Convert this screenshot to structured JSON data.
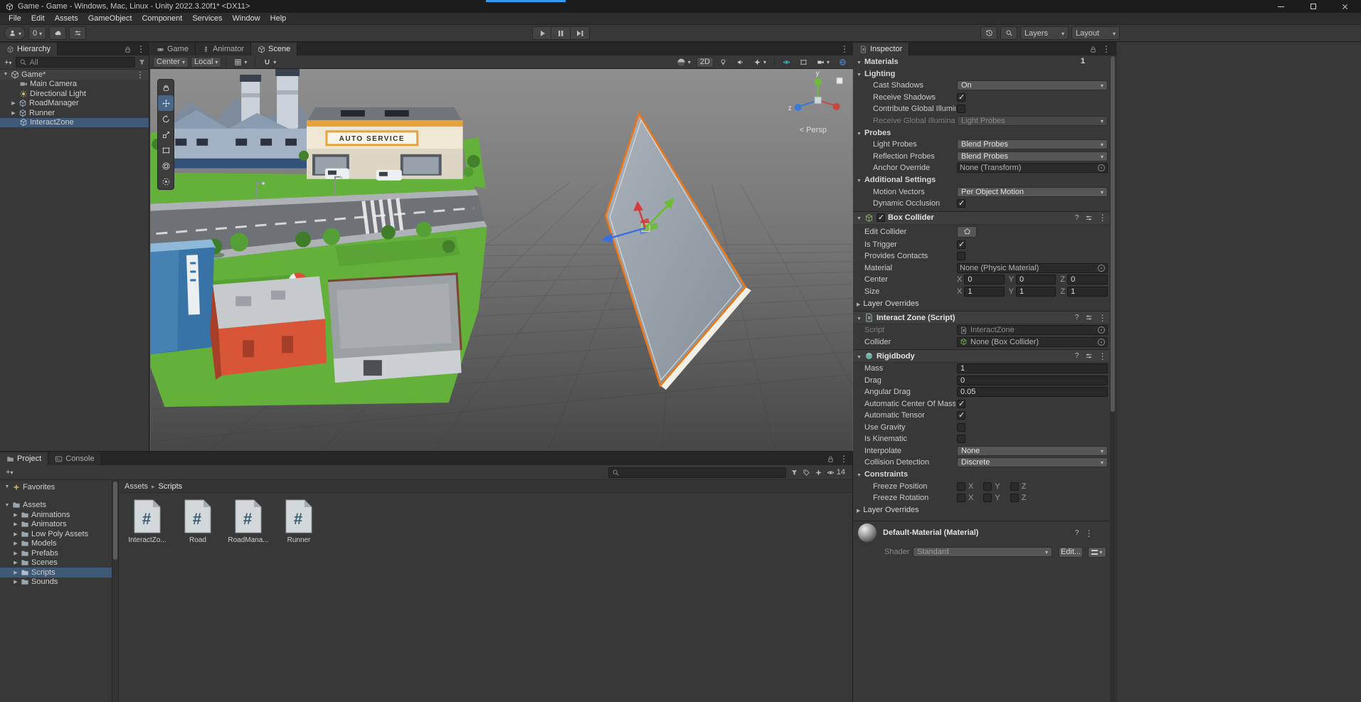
{
  "colors": {
    "selection": "#3e5a77",
    "accent_blue": "#2f9df4",
    "selection_outline_orange": "#f0750f",
    "panel": "#383838"
  },
  "titlebar": {
    "title": "Game - Game - Windows, Mac, Linux - Unity 2022.3.20f1* <DX11>"
  },
  "menubar": {
    "items": [
      "File",
      "Edit",
      "Assets",
      "GameObject",
      "Component",
      "Services",
      "Window",
      "Help"
    ]
  },
  "toolbar": {
    "collab_count": "0",
    "layers_label": "Layers",
    "layout_label": "Layout"
  },
  "hierarchy": {
    "tab": "Hierarchy",
    "search_filter": "All",
    "scene_row": "Game*",
    "items": [
      {
        "label": "Main Camera"
      },
      {
        "label": "Directional Light"
      },
      {
        "label": "RoadManager"
      },
      {
        "label": "Runner"
      },
      {
        "label": "InteractZone"
      }
    ]
  },
  "scene": {
    "tabs": [
      "Game",
      "Animator",
      "Scene"
    ],
    "pivot": "Center",
    "space": "Local",
    "mode_2d": "2D",
    "persp_label": "< Persp",
    "axis_y": "y",
    "axis_z": "z",
    "sign_text": "AUTO SERVICE"
  },
  "project": {
    "tabs": [
      "Project",
      "Console"
    ],
    "favorites": "Favorites",
    "root": "Assets",
    "folders": [
      "Animations",
      "Animators",
      "Low Poly Assets",
      "Models",
      "Prefabs",
      "Scenes",
      "Scripts",
      "Sounds"
    ],
    "breadcrumb": [
      "Assets",
      "Scripts"
    ],
    "files": [
      "InteractZo...",
      "Road",
      "RoadMana...",
      "Runner"
    ],
    "hidden_count": "14"
  },
  "inspector": {
    "tab": "Inspector",
    "axes": [
      "X",
      "Y",
      "Z"
    ],
    "materials": {
      "label": "Materials",
      "count": "1"
    },
    "lighting": {
      "title": "Lighting",
      "cast_shadows": {
        "label": "Cast Shadows",
        "value": "On"
      },
      "receive_shadows": {
        "label": "Receive Shadows",
        "checked": true
      },
      "contribute_gi": {
        "label": "Contribute Global Illumina",
        "checked": false
      },
      "receive_gi": {
        "label": "Receive Global Illuminatio",
        "value": "Light Probes"
      }
    },
    "probes": {
      "title": "Probes",
      "light_probes": {
        "label": "Light Probes",
        "value": "Blend Probes"
      },
      "reflection_probes": {
        "label": "Reflection Probes",
        "value": "Blend Probes"
      },
      "anchor_override": {
        "label": "Anchor Override",
        "value": "None (Transform)"
      }
    },
    "additional": {
      "title": "Additional Settings",
      "motion_vectors": {
        "label": "Motion Vectors",
        "value": "Per Object Motion"
      },
      "dynamic_occlusion": {
        "label": "Dynamic Occlusion",
        "checked": true
      }
    },
    "box_collider": {
      "title": "Box Collider",
      "enabled": true,
      "edit_collider": {
        "label": "Edit Collider"
      },
      "is_trigger": {
        "label": "Is Trigger",
        "checked": true
      },
      "provides_contacts": {
        "label": "Provides Contacts",
        "checked": false
      },
      "material": {
        "label": "Material",
        "value": "None (Physic Material)"
      },
      "center": {
        "label": "Center",
        "x": "0",
        "y": "0",
        "z": "0"
      },
      "size": {
        "label": "Size",
        "x": "1",
        "y": "1",
        "z": "1"
      },
      "layer_overrides": "Layer Overrides"
    },
    "interact_zone": {
      "title": "Interact Zone (Script)",
      "script": {
        "label": "Script",
        "value": "InteractZone"
      },
      "collider": {
        "label": "Collider",
        "value": "None (Box Collider)"
      }
    },
    "rigidbody": {
      "title": "Rigidbody",
      "mass": {
        "label": "Mass",
        "value": "1"
      },
      "drag": {
        "label": "Drag",
        "value": "0"
      },
      "angular_drag": {
        "label": "Angular Drag",
        "value": "0.05"
      },
      "auto_com": {
        "label": "Automatic Center Of Mass",
        "checked": true
      },
      "auto_tensor": {
        "label": "Automatic Tensor",
        "checked": true
      },
      "use_gravity": {
        "label": "Use Gravity",
        "checked": false
      },
      "is_kinematic": {
        "label": "Is Kinematic",
        "checked": false
      },
      "interpolate": {
        "label": "Interpolate",
        "value": "None"
      },
      "collision_detection": {
        "label": "Collision Detection",
        "value": "Discrete"
      },
      "constraints": {
        "title": "Constraints",
        "freeze_position": {
          "label": "Freeze Position",
          "x": false,
          "y": false,
          "z": false
        },
        "freeze_rotation": {
          "label": "Freeze Rotation",
          "x": false,
          "y": false,
          "z": false
        }
      },
      "layer_overrides": "Layer Overrides"
    },
    "material_footer": {
      "title": "Default-Material (Material)",
      "shader": {
        "label": "Shader",
        "value": "Standard"
      },
      "edit_label": "Edit..."
    }
  }
}
